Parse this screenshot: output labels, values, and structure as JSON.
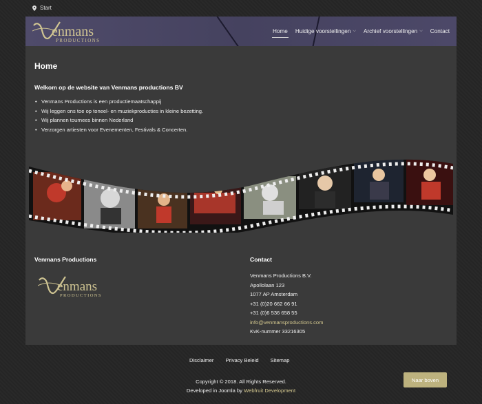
{
  "breadcrumb": {
    "label": "Start"
  },
  "brand": {
    "name": "enmans",
    "initial": "V",
    "sub": "PRODUCTIONS"
  },
  "nav": {
    "home": "Home",
    "current": "Huidige voorstellingen",
    "archive": "Archief voorstellingen",
    "contact": "Contact"
  },
  "page": {
    "title": "Home",
    "welcome": "Welkom op de website van Venmans productions BV",
    "bullets": [
      "Venmans Productions is een productiemaatschappij",
      "Wij leggen ons toe op toneel- en muziekproducties in kleine bezetting.",
      "Wij plannen tournees binnen Nederland",
      "Verzorgen artiesten voor Evenementen, Festivals & Concerten."
    ]
  },
  "footer": {
    "left_title": "Venmans Productions",
    "contact_title": "Contact",
    "contact": {
      "company": "Venmans Productions B.V.",
      "street": "Apollolaan 123",
      "city": "1077 AP Amsterdam",
      "phone1": "+31 (0)20 662 66 91",
      "phone2": "+31 (0)6 536 658 55",
      "email": "info@venmansproductions.com",
      "kvk": "KvK-nummer 33216305"
    },
    "links": {
      "disclaimer": "Disclaimer",
      "privacy": "Privacy Beleid",
      "sitemap": "Sitemap"
    },
    "copyright": "Copyright © 2018. All Rights Reserved.",
    "developed": "Developed in Joomla by",
    "developer": "Webfruit Development",
    "top_button": "Naar boven"
  },
  "colors": {
    "accent": "#d4c88f",
    "button": "#bdb27e",
    "header": "#4f4b6a"
  }
}
